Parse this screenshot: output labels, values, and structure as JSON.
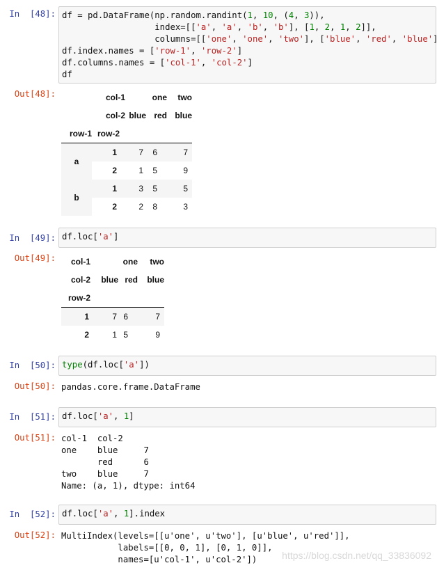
{
  "cells": [
    {
      "in_prompt": "In  [48]:",
      "code_lines": [
        [
          [
            "df = pd.DataFrame(np.random.randint(",
            "plain"
          ],
          [
            "1",
            "num"
          ],
          [
            ", ",
            "plain"
          ],
          [
            "10",
            "num"
          ],
          [
            ", (",
            "plain"
          ],
          [
            "4",
            "num"
          ],
          [
            ", ",
            "plain"
          ],
          [
            "3",
            "num"
          ],
          [
            ")),",
            "plain"
          ]
        ],
        [
          [
            "                  index=[[",
            "plain"
          ],
          [
            "'a'",
            "str"
          ],
          [
            ", ",
            "plain"
          ],
          [
            "'a'",
            "str"
          ],
          [
            ", ",
            "plain"
          ],
          [
            "'b'",
            "str"
          ],
          [
            ", ",
            "plain"
          ],
          [
            "'b'",
            "str"
          ],
          [
            "], [",
            "plain"
          ],
          [
            "1",
            "num"
          ],
          [
            ", ",
            "plain"
          ],
          [
            "2",
            "num"
          ],
          [
            ", ",
            "plain"
          ],
          [
            "1",
            "num"
          ],
          [
            ", ",
            "plain"
          ],
          [
            "2",
            "num"
          ],
          [
            "]],",
            "plain"
          ]
        ],
        [
          [
            "                  columns=[[",
            "plain"
          ],
          [
            "'one'",
            "str"
          ],
          [
            ", ",
            "plain"
          ],
          [
            "'one'",
            "str"
          ],
          [
            ", ",
            "plain"
          ],
          [
            "'two'",
            "str"
          ],
          [
            "], [",
            "plain"
          ],
          [
            "'blue'",
            "str"
          ],
          [
            ", ",
            "plain"
          ],
          [
            "'red'",
            "str"
          ],
          [
            ", ",
            "plain"
          ],
          [
            "'blue'",
            "str"
          ],
          [
            "]])",
            "plain"
          ]
        ],
        [
          [
            "df.index.names = [",
            "plain"
          ],
          [
            "'row-1'",
            "str"
          ],
          [
            ", ",
            "plain"
          ],
          [
            "'row-2'",
            "str"
          ],
          [
            "]",
            "plain"
          ]
        ],
        [
          [
            "df.columns.names = [",
            "plain"
          ],
          [
            "'col-1'",
            "str"
          ],
          [
            ", ",
            "plain"
          ],
          [
            "'col-2'",
            "str"
          ],
          [
            "]",
            "plain"
          ]
        ],
        [
          [
            "df",
            "plain"
          ]
        ]
      ],
      "out_prompt": "Out[48]:"
    },
    {
      "in_prompt": "In  [49]:",
      "code_lines": [
        [
          [
            "df.loc[",
            "plain"
          ],
          [
            "'a'",
            "str"
          ],
          [
            "]",
            "plain"
          ]
        ]
      ],
      "out_prompt": "Out[49]:"
    },
    {
      "in_prompt": "In  [50]:",
      "code_lines": [
        [
          [
            "type",
            "kw"
          ],
          [
            "(df.loc[",
            "plain"
          ],
          [
            "'a'",
            "str"
          ],
          [
            "])",
            "plain"
          ]
        ]
      ],
      "out_prompt": "Out[50]:",
      "out_text": "pandas.core.frame.DataFrame"
    },
    {
      "in_prompt": "In  [51]:",
      "code_lines": [
        [
          [
            "df.loc[",
            "plain"
          ],
          [
            "'a'",
            "str"
          ],
          [
            ", ",
            "plain"
          ],
          [
            "1",
            "num"
          ],
          [
            "]",
            "plain"
          ]
        ]
      ],
      "out_prompt": "Out[51]:",
      "out_text": "col-1  col-2\none    blue     7\n       red      6\ntwo    blue     7\nName: (a, 1), dtype: int64"
    },
    {
      "in_prompt": "In  [52]:",
      "code_lines": [
        [
          [
            "df.loc[",
            "plain"
          ],
          [
            "'a'",
            "str"
          ],
          [
            ", ",
            "plain"
          ],
          [
            "1",
            "num"
          ],
          [
            "].index",
            "plain"
          ]
        ]
      ],
      "out_prompt": "Out[52]:",
      "out_text": "MultiIndex(levels=[[u'one', u'two'], [u'blue', u'red']],\n           labels=[[0, 0, 1], [0, 1, 0]],\n           names=[u'col-1', u'col-2'])"
    }
  ],
  "df48": {
    "col1_name": "col-1",
    "col1_headers": [
      "one",
      "two"
    ],
    "col2_name": "col-2",
    "col2_headers": [
      "blue",
      "red",
      "blue"
    ],
    "idx_names": [
      "row-1",
      "row-2"
    ],
    "rows": [
      {
        "l1": "a",
        "l2": "1",
        "vals": [
          "7",
          "6",
          "7"
        ]
      },
      {
        "l1": "",
        "l2": "2",
        "vals": [
          "1",
          "5",
          "9"
        ]
      },
      {
        "l1": "b",
        "l2": "1",
        "vals": [
          "3",
          "5",
          "5"
        ]
      },
      {
        "l1": "",
        "l2": "2",
        "vals": [
          "2",
          "8",
          "3"
        ]
      }
    ]
  },
  "df49": {
    "col1_name": "col-1",
    "col1_headers": [
      "one",
      "two"
    ],
    "col2_name": "col-2",
    "col2_headers": [
      "blue",
      "red",
      "blue"
    ],
    "idx_name": "row-2",
    "rows": [
      {
        "idx": "1",
        "vals": [
          "7",
          "6",
          "7"
        ]
      },
      {
        "idx": "2",
        "vals": [
          "1",
          "5",
          "9"
        ]
      }
    ]
  },
  "watermark": "https://blog.csdn.net/qq_33836092"
}
